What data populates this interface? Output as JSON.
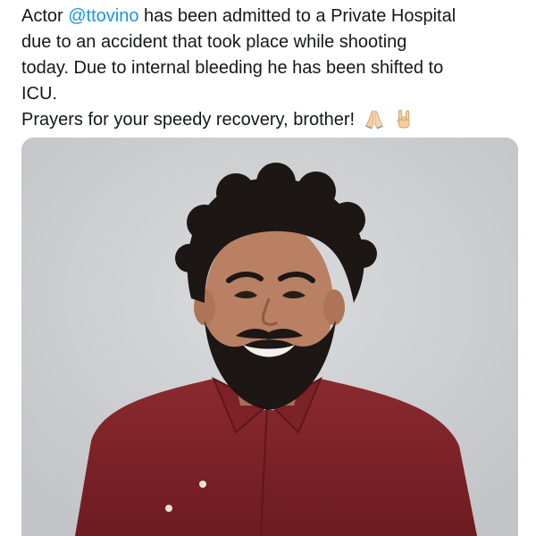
{
  "tweet": {
    "text_prefix": "Actor ",
    "mention": "@ttovino",
    "text_line1_rest": " has been admitted to a Private Hospital",
    "text_line2": "due to an accident that took place while shooting",
    "text_line3": "today. Due to internal bleeding he has been shifted to",
    "text_line4": "ICU.",
    "text_line5": "Prayers for your speedy recovery, brother!",
    "emojis": [
      "folded-hands-icon",
      "sign-of-horns-icon"
    ]
  },
  "media": {
    "type": "photo",
    "subject": "portrait of a smiling bearded man with curly hair in a maroon shirt",
    "colors": {
      "background": "#cfd0d2",
      "shirt": "#7a1f24",
      "hair": "#1c1614",
      "skin": "#b98063"
    }
  },
  "colors": {
    "text": "#14171a",
    "link": "#1b95e0"
  }
}
